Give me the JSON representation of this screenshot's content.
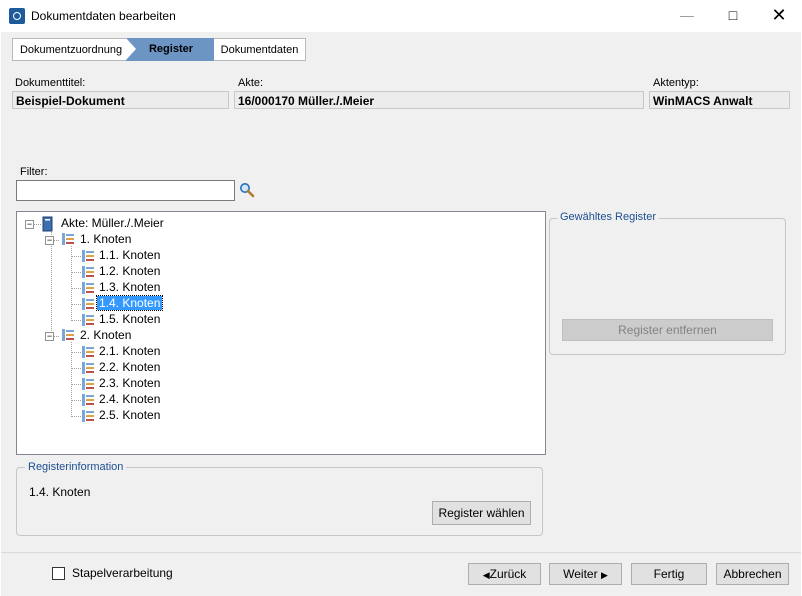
{
  "window": {
    "title": "Dokumentdaten bearbeiten"
  },
  "steps": [
    "Dokumentzuordnung",
    "Register",
    "Dokumentdaten"
  ],
  "fields": {
    "dokumenttitel_label": "Dokumenttitel:",
    "dokumenttitel_value": "Beispiel-Dokument",
    "akte_label": "Akte:",
    "akte_value": "16/000170 Müller./.Meier",
    "aktentyp_label": "Aktentyp:",
    "aktentyp_value": "WinMACS Anwalt"
  },
  "filter": {
    "label": "Filter:",
    "value": ""
  },
  "tree": {
    "root": "Akte: Müller./.Meier",
    "n1": "1. Knoten",
    "n1_1": "1.1. Knoten",
    "n1_2": "1.2. Knoten",
    "n1_3": "1.3. Knoten",
    "n1_4": "1.4. Knoten",
    "n1_5": "1.5. Knoten",
    "n2": "2. Knoten",
    "n2_1": "2.1. Knoten",
    "n2_2": "2.2. Knoten",
    "n2_3": "2.3. Knoten",
    "n2_4": "2.4. Knoten",
    "n2_5": "2.5. Knoten"
  },
  "selected_register": {
    "title": "Gewähltes Register",
    "remove_label": "Register entfernen"
  },
  "register_info": {
    "title": "Registerinformation",
    "value": "1.4. Knoten",
    "choose_label": "Register wählen"
  },
  "footer": {
    "batch_label": "Stapelverarbeitung",
    "back_label": "Zurück",
    "next_label": "Weiter",
    "finish_label": "Fertig",
    "cancel_label": "Abbrechen"
  },
  "colors": {
    "step_active": "#6c95c4",
    "selection": "#3399ff",
    "group_title": "#1d4f91"
  },
  "icons": [
    "app-icon",
    "search-icon",
    "file-icon",
    "register-icon",
    "triangle-left-icon",
    "triangle-right-icon"
  ]
}
